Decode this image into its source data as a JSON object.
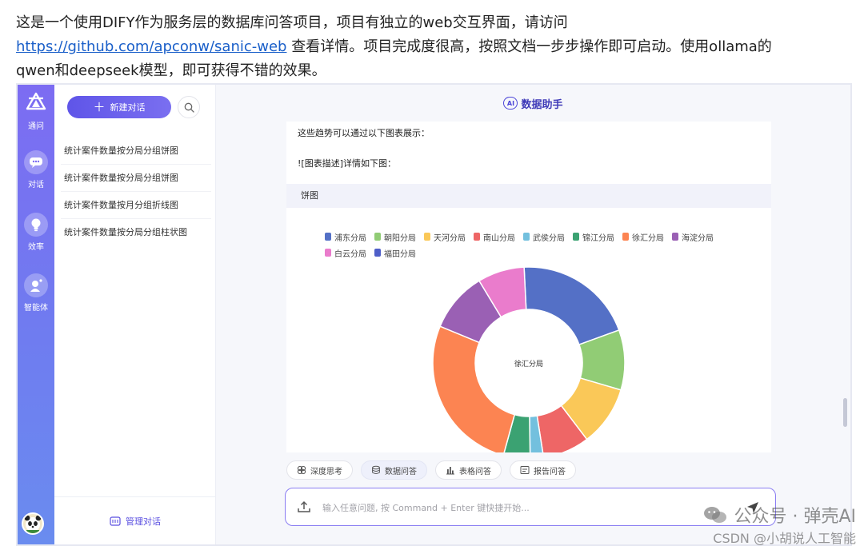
{
  "article": {
    "line1": "这是一个使用DIFY作为服务层的数据库问答项目，项目有独立的web交互界面，请访问",
    "link": "https://github.com/apconw/sanic-web",
    "line2_after_link": " 查看详情。项目完成度很高，按照文档一步步操作即可启动。使用ollama的",
    "line3": "qwen和deepseek模型，即可获得不错的效果。"
  },
  "rail": {
    "logo_label": "通问",
    "items": [
      {
        "label": "对话",
        "icon": "chat-icon"
      },
      {
        "label": "效率",
        "icon": "lightbulb-icon"
      },
      {
        "label": "智能体",
        "icon": "agent-icon"
      }
    ],
    "avatar_icon": "panda-avatar"
  },
  "sidebar": {
    "new_chat_label": "新建对话",
    "history": [
      "统计案件数量按分局分组饼图",
      "统计案件数量按分局分组饼图",
      "统计案件数量按月分组折线图",
      "统计案件数量按分局分组柱状图"
    ],
    "footer_label": "管理对话"
  },
  "main": {
    "header_badge": "AI",
    "header_title": "数据助手",
    "msg_line1": "这些趋势可以通过以下图表展示：",
    "msg_line2": "![图表描述]详情如下图：",
    "chart_strip_label": "饼图",
    "chips": [
      {
        "label": "深度思考",
        "icon": "deep-think-icon",
        "active": false
      },
      {
        "label": "数据问答",
        "icon": "database-icon",
        "active": true
      },
      {
        "label": "表格问答",
        "icon": "table-chart-icon",
        "active": false
      },
      {
        "label": "报告问答",
        "icon": "report-icon",
        "active": false
      }
    ],
    "input_placeholder": "输入任意问题, 按 Command + Enter 键快捷开始..."
  },
  "watermark": {
    "line1": "公众号 · 弹壳AI",
    "line2": "CSDN @小胡说人工智能"
  },
  "chart_data": {
    "type": "pie",
    "donut": true,
    "center_label": "徐汇分局",
    "categories": [
      "浦东分局",
      "朝阳分局",
      "天河分局",
      "南山分局",
      "武侯分局",
      "锦江分局",
      "徐汇分局",
      "海淀分局",
      "白云分局",
      "福田分局"
    ],
    "values": [
      18,
      9,
      9,
      7,
      2,
      4,
      24,
      9,
      7,
      0
    ],
    "colors": [
      "#5470c6",
      "#91cc75",
      "#fac858",
      "#ee6666",
      "#73c0de",
      "#3ba272",
      "#fc8452",
      "#9a60b4",
      "#ea7ccc",
      "#4e5ec8"
    ],
    "legend_position": "top"
  }
}
